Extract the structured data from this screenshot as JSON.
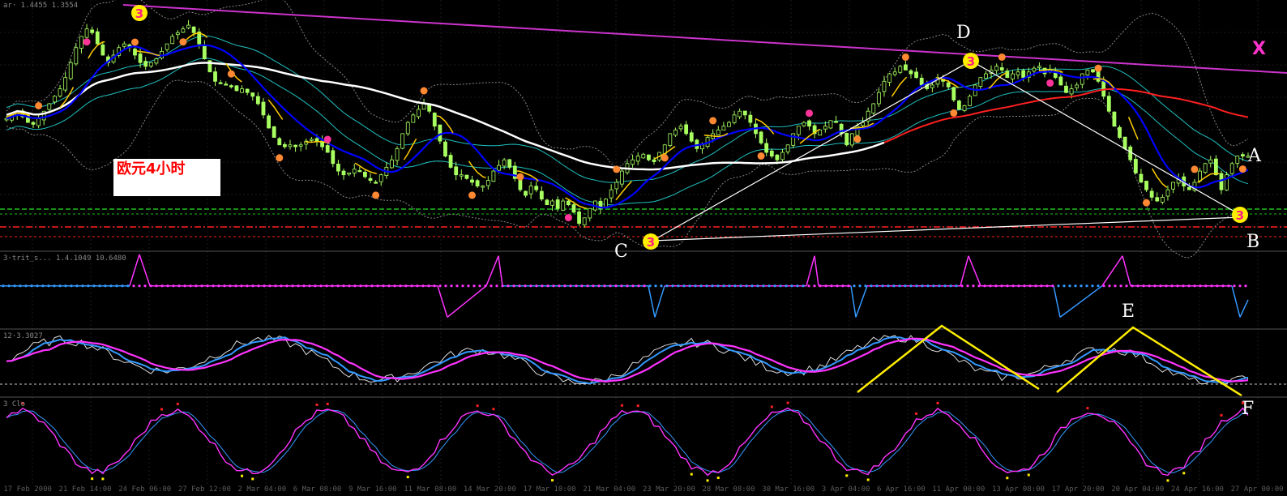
{
  "title": "欧元4小时",
  "pattern_labels": {
    "x": "X",
    "a": "A",
    "b": "B",
    "c": "C",
    "d": "D",
    "e": "E",
    "f": "F"
  },
  "panel_headers": {
    "main": "ar· 1.4455 1.3554",
    "ind1": "3·trit_s... 1.4.1049 10.6480",
    "ind2": "12·3.3027",
    "ind3": "3 Clo"
  },
  "time_axis": [
    "17 Feb 2000",
    "21 Feb 14:00",
    "24 Feb 06:00",
    "27 Feb 12:00",
    "2 Mar 04:00",
    "6 Mar 08:00",
    "9 Mar 16:00",
    "11 Mar 08:00",
    "14 Mar 20:00",
    "17 Mar 10:00",
    "21 Mar 04:00",
    "23 Mar 20:00",
    "28 Mar 08:00",
    "30 Mar 16:00",
    "3 Apr 04:00",
    "6 Apr 16:00",
    "11 Apr 00:00",
    "13 Apr 08:00",
    "17 Apr 20:00",
    "20 Apr 04:00",
    "24 Apr 16:00",
    "27 Apr 00:00"
  ],
  "colors": {
    "background": "#000000",
    "candle": "#a8ff60",
    "ma_fast": "#0000ff",
    "ma_slow": "#ff2020",
    "ma_long": "#ffffff",
    "signal_line": "#ffcc00",
    "envelope": "#20c0c0",
    "trend_line": "#cc33cc",
    "support_green": "#20c020",
    "support_red": "#ff2020",
    "osc_main": "#ff33ff",
    "osc_signal": "#3399ff",
    "pattern_yellow": "#ffee00",
    "marker_orange": "#ff8833",
    "marker_pink": "#ff3399",
    "marker_yellow": "#ffee00"
  },
  "chart_data": [
    {
      "type": "line",
      "name": "price",
      "x_count": 232,
      "close": [
        1.4,
        1.402,
        1.404,
        1.401,
        1.398,
        1.397,
        1.4,
        1.404,
        1.408,
        1.412,
        1.416,
        1.422,
        1.43,
        1.438,
        1.444,
        1.448,
        1.446,
        1.44,
        1.434,
        1.43,
        1.434,
        1.438,
        1.44,
        1.438,
        1.434,
        1.43,
        1.428,
        1.43,
        1.432,
        1.436,
        1.44,
        1.444,
        1.446,
        1.448,
        1.45,
        1.446,
        1.44,
        1.432,
        1.425,
        1.42,
        1.419,
        1.418,
        1.417,
        1.415,
        1.416,
        1.414,
        1.412,
        1.408,
        1.402,
        1.395,
        1.39,
        1.386,
        1.385,
        1.386,
        1.385,
        1.386,
        1.388,
        1.389,
        1.388,
        1.385,
        1.382,
        1.376,
        1.372,
        1.37,
        1.371,
        1.373,
        1.372,
        1.369,
        1.367,
        1.366,
        1.37,
        1.374,
        1.378,
        1.384,
        1.392,
        1.398,
        1.402,
        1.405,
        1.408,
        1.404,
        1.396,
        1.388,
        1.38,
        1.374,
        1.37,
        1.37,
        1.368,
        1.366,
        1.364,
        1.364,
        1.367,
        1.372,
        1.375,
        1.378,
        1.374,
        1.368,
        1.362,
        1.359,
        1.364,
        1.362,
        1.357,
        1.354,
        1.356,
        1.352,
        1.356,
        1.354,
        1.35,
        1.344,
        1.347,
        1.352,
        1.356,
        1.352,
        1.357,
        1.362,
        1.366,
        1.372,
        1.376,
        1.378,
        1.38,
        1.381,
        1.378,
        1.377,
        1.382,
        1.386,
        1.392,
        1.394,
        1.396,
        1.392,
        1.388,
        1.384,
        1.386,
        1.39,
        1.392,
        1.394,
        1.396,
        1.398,
        1.402,
        1.404,
        1.402,
        1.398,
        1.392,
        1.387,
        1.382,
        1.38,
        1.378,
        1.382,
        1.386,
        1.392,
        1.396,
        1.398,
        1.396,
        1.392,
        1.394,
        1.396,
        1.399,
        1.398,
        1.392,
        1.386,
        1.392,
        1.396,
        1.398,
        1.404,
        1.408,
        1.414,
        1.42,
        1.424,
        1.425,
        1.428,
        1.426,
        1.424,
        1.422,
        1.418,
        1.416,
        1.418,
        1.422,
        1.42,
        1.417,
        1.41,
        1.405,
        1.407,
        1.412,
        1.418,
        1.422,
        1.424,
        1.426,
        1.428,
        1.426,
        1.422,
        1.424,
        1.425,
        1.422,
        1.425,
        1.427,
        1.428,
        1.424,
        1.426,
        1.422,
        1.418,
        1.414,
        1.416,
        1.418,
        1.424,
        1.426,
        1.425,
        1.42,
        1.412,
        1.404,
        1.396,
        1.39,
        1.384,
        1.378,
        1.371,
        1.366,
        1.362,
        1.358,
        1.356,
        1.358,
        1.362,
        1.366,
        1.368,
        1.364,
        1.362,
        1.366,
        1.372,
        1.376,
        1.378,
        1.37,
        1.362,
        1.37,
        1.376,
        1.38,
        1.38,
        1.38
      ],
      "ylim": [
        1.33,
        1.46
      ]
    },
    {
      "type": "line",
      "name": "step_indicator",
      "ylim": [
        0,
        1
      ]
    },
    {
      "type": "line",
      "name": "oscillator",
      "ylim": [
        0,
        100
      ]
    },
    {
      "type": "line",
      "name": "stochastic",
      "ylim": [
        0,
        100
      ]
    }
  ]
}
